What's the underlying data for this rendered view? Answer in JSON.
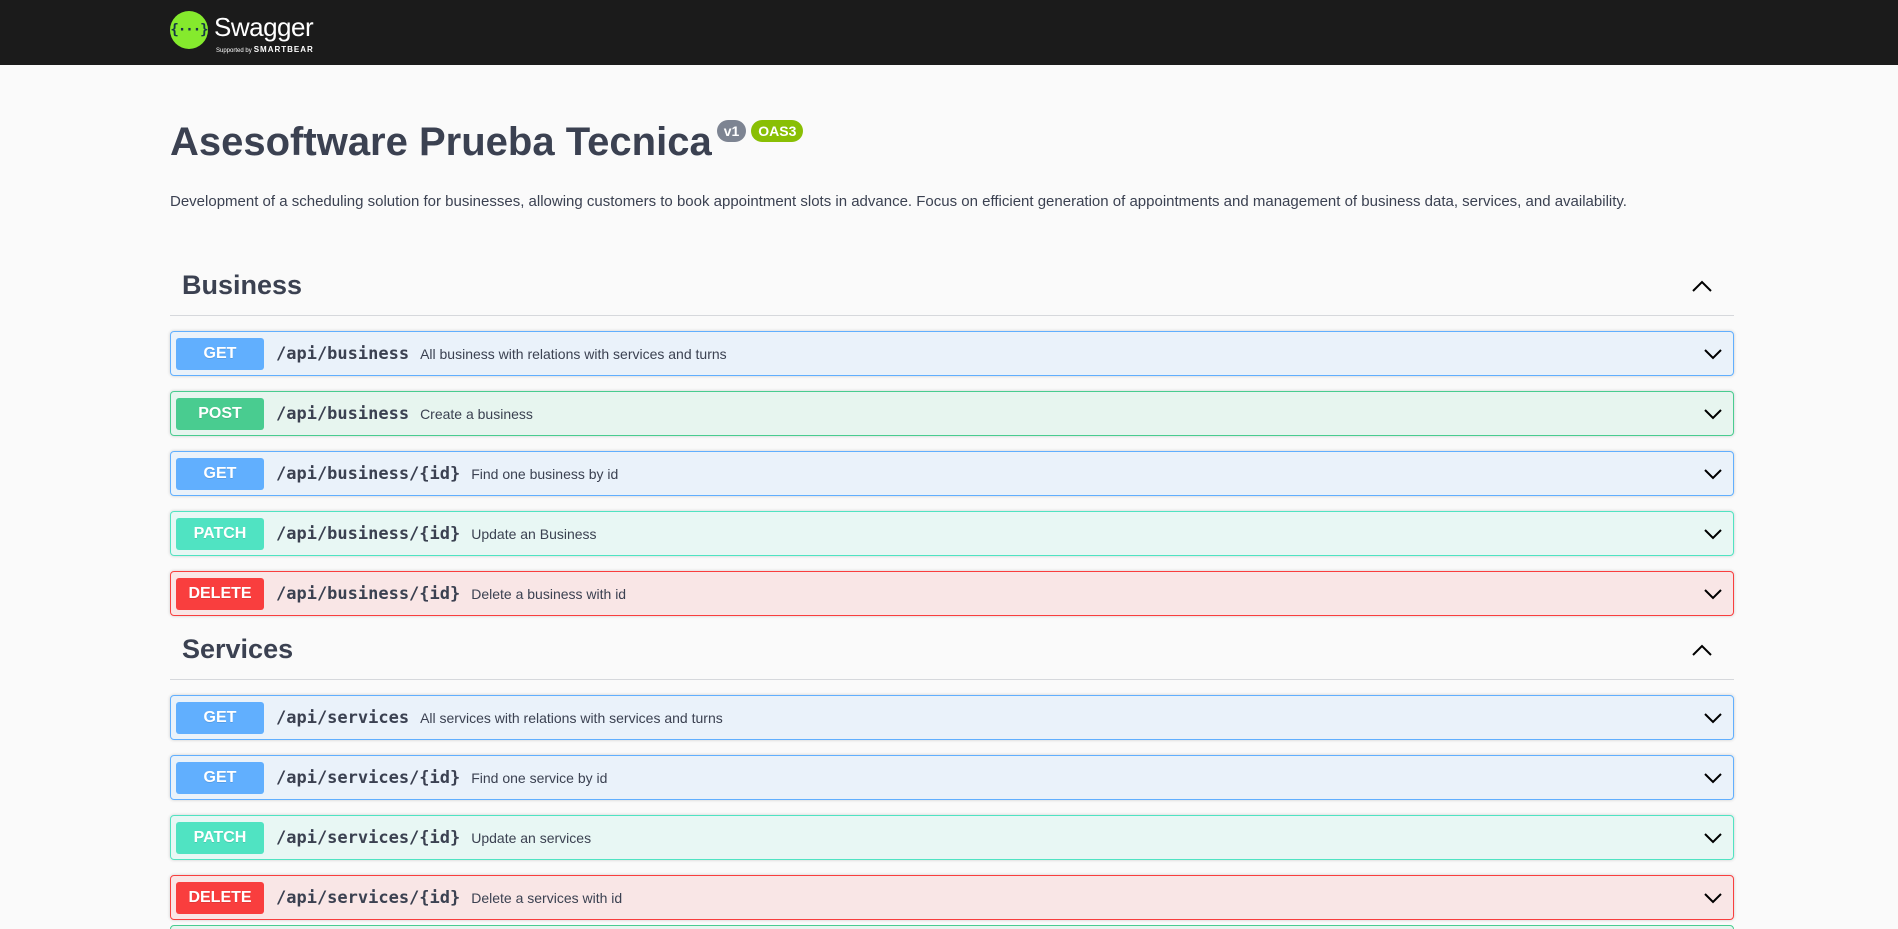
{
  "topbar": {
    "logo_icon": "{···}",
    "logo_name": "Swagger",
    "logo_sub_prefix": "Supported by",
    "logo_sub_brand": "SMARTBEAR"
  },
  "info": {
    "title": "Asesoftware Prueba Tecnica",
    "version": "v1",
    "oas": "OAS3",
    "description": "Development of a scheduling solution for businesses, allowing customers to book appointment slots in advance. Focus on efficient generation of appointments and management of business data, services, and availability."
  },
  "colors": {
    "get": "#61affe",
    "post": "#49cc90",
    "patch": "#50e3c2",
    "delete": "#f93e3e",
    "topbar": "#1b1b1b",
    "logo_green": "#85ea2d"
  },
  "sections": [
    {
      "name": "Business",
      "toggle_icon": "chevron-up-icon",
      "operations": [
        {
          "method": "GET",
          "path": "/api/business",
          "summary": "All business with relations with services and turns"
        },
        {
          "method": "POST",
          "path": "/api/business",
          "summary": "Create a business"
        },
        {
          "method": "GET",
          "path": "/api/business/{id}",
          "summary": "Find one business by id"
        },
        {
          "method": "PATCH",
          "path": "/api/business/{id}",
          "summary": "Update an Business"
        },
        {
          "method": "DELETE",
          "path": "/api/business/{id}",
          "summary": "Delete a business with id"
        }
      ]
    },
    {
      "name": "Services",
      "toggle_icon": "chevron-up-icon",
      "operations": [
        {
          "method": "GET",
          "path": "/api/services",
          "summary": "All services with relations with services and turns"
        },
        {
          "method": "GET",
          "path": "/api/services/{id}",
          "summary": "Find one service by id"
        },
        {
          "method": "PATCH",
          "path": "/api/services/{id}",
          "summary": "Update an services"
        },
        {
          "method": "DELETE",
          "path": "/api/services/{id}",
          "summary": "Delete a services with id"
        }
      ]
    }
  ]
}
